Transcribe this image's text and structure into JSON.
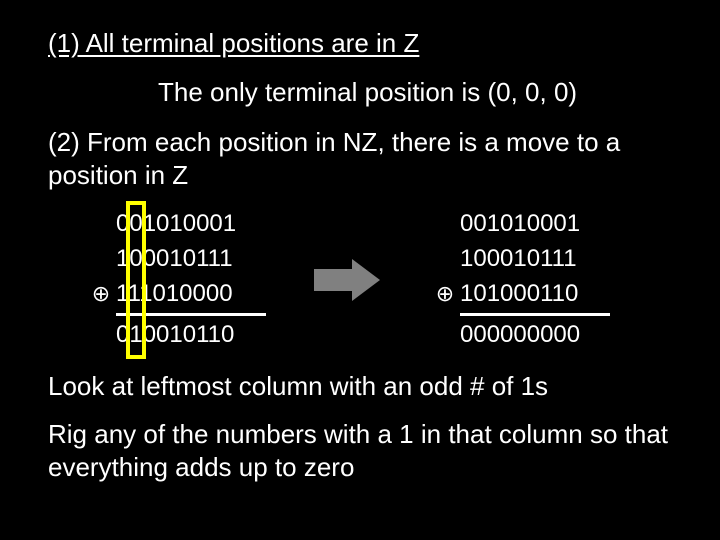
{
  "line1": "(1) All terminal positions are in Z",
  "sub": "The only terminal position is (0, 0, 0)",
  "line2": "(2) From each position in NZ, there is a move to a position in Z",
  "op_symbol": "⊕",
  "left_block": {
    "r0": "001010001",
    "r1": "100010111",
    "r2": "111010000",
    "res": "010010110"
  },
  "right_block": {
    "r0": "001010001",
    "r1": "100010111",
    "r2": "101000110",
    "res": "000000000"
  },
  "footer1": "Look at leftmost column with an odd # of 1s",
  "footer2": "Rig any of the numbers with a 1 in that column so that everything adds up to zero"
}
